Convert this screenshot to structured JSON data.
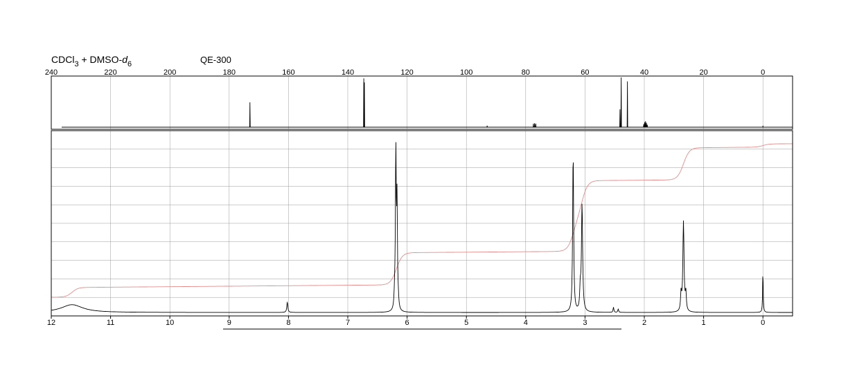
{
  "header": {
    "solvent_parts": [
      "CDCl",
      "3",
      " + DMSO-",
      "d",
      "6"
    ],
    "instrument": "QE-300"
  },
  "chart_data": [
    {
      "type": "line",
      "nucleus": "13C",
      "xlim": [
        240,
        -10
      ],
      "x_reversed": true,
      "x_ticks": [
        240,
        220,
        200,
        180,
        160,
        140,
        120,
        100,
        80,
        60,
        40,
        20,
        0
      ],
      "grid": true,
      "peaks": [
        {
          "ppm": 173.0,
          "height": 0.5
        },
        {
          "ppm": 134.6,
          "height": 0.98
        },
        {
          "ppm": 134.4,
          "height": 0.9
        },
        {
          "ppm": 93.0,
          "height": 0.03
        },
        {
          "ppm": 77.4,
          "height": 0.07
        },
        {
          "ppm": 77.0,
          "height": 0.08
        },
        {
          "ppm": 76.6,
          "height": 0.07
        },
        {
          "ppm": 48.2,
          "height": 0.36
        },
        {
          "ppm": 47.8,
          "height": 1.0
        },
        {
          "ppm": 45.7,
          "height": 0.92
        },
        {
          "ppm": 40.2,
          "height": 0.06
        },
        {
          "ppm": 39.9,
          "height": 0.1
        },
        {
          "ppm": 39.6,
          "height": 0.12
        },
        {
          "ppm": 39.3,
          "height": 0.09
        },
        {
          "ppm": 39.0,
          "height": 0.05
        },
        {
          "ppm": 0.0,
          "height": 0.02
        }
      ]
    },
    {
      "type": "line",
      "nucleus": "1H",
      "xlim": [
        12,
        -0.5
      ],
      "x_reversed": true,
      "x_ticks": [
        12,
        11,
        10,
        9,
        8,
        7,
        6,
        5,
        4,
        3,
        2,
        1,
        0
      ],
      "grid": true,
      "peaks": [
        {
          "ppm": 11.65,
          "height": 0.045,
          "width": 0.22
        },
        {
          "ppm": 8.02,
          "height": 0.06,
          "width": 0.01
        },
        {
          "ppm": 6.19,
          "height": 0.92,
          "width": 0.008
        },
        {
          "ppm": 6.17,
          "height": 0.6,
          "width": 0.008
        },
        {
          "ppm": 6.21,
          "height": 0.08,
          "width": 0.01
        },
        {
          "ppm": 6.15,
          "height": 0.05,
          "width": 0.01
        },
        {
          "ppm": 3.2,
          "height": 0.92,
          "width": 0.01
        },
        {
          "ppm": 3.05,
          "height": 0.62,
          "width": 0.012
        },
        {
          "ppm": 3.08,
          "height": 0.12,
          "width": 0.01
        },
        {
          "ppm": 2.52,
          "height": 0.03,
          "width": 0.008
        },
        {
          "ppm": 2.44,
          "height": 0.02,
          "width": 0.008
        },
        {
          "ppm": 1.34,
          "height": 0.52,
          "width": 0.012
        },
        {
          "ppm": 1.38,
          "height": 0.1,
          "width": 0.01
        },
        {
          "ppm": 1.3,
          "height": 0.1,
          "width": 0.01
        },
        {
          "ppm": 0.0,
          "height": 0.24,
          "width": 0.006
        }
      ],
      "integral_steps": [
        {
          "ppm": 11.65,
          "rise": 0.06
        },
        {
          "ppm": 6.18,
          "rise": 0.2
        },
        {
          "ppm": 3.2,
          "rise": 0.2
        },
        {
          "ppm": 3.05,
          "rise": 0.24
        },
        {
          "ppm": 1.34,
          "rise": 0.2
        },
        {
          "ppm": 0.0,
          "rise": 0.02
        }
      ]
    }
  ]
}
